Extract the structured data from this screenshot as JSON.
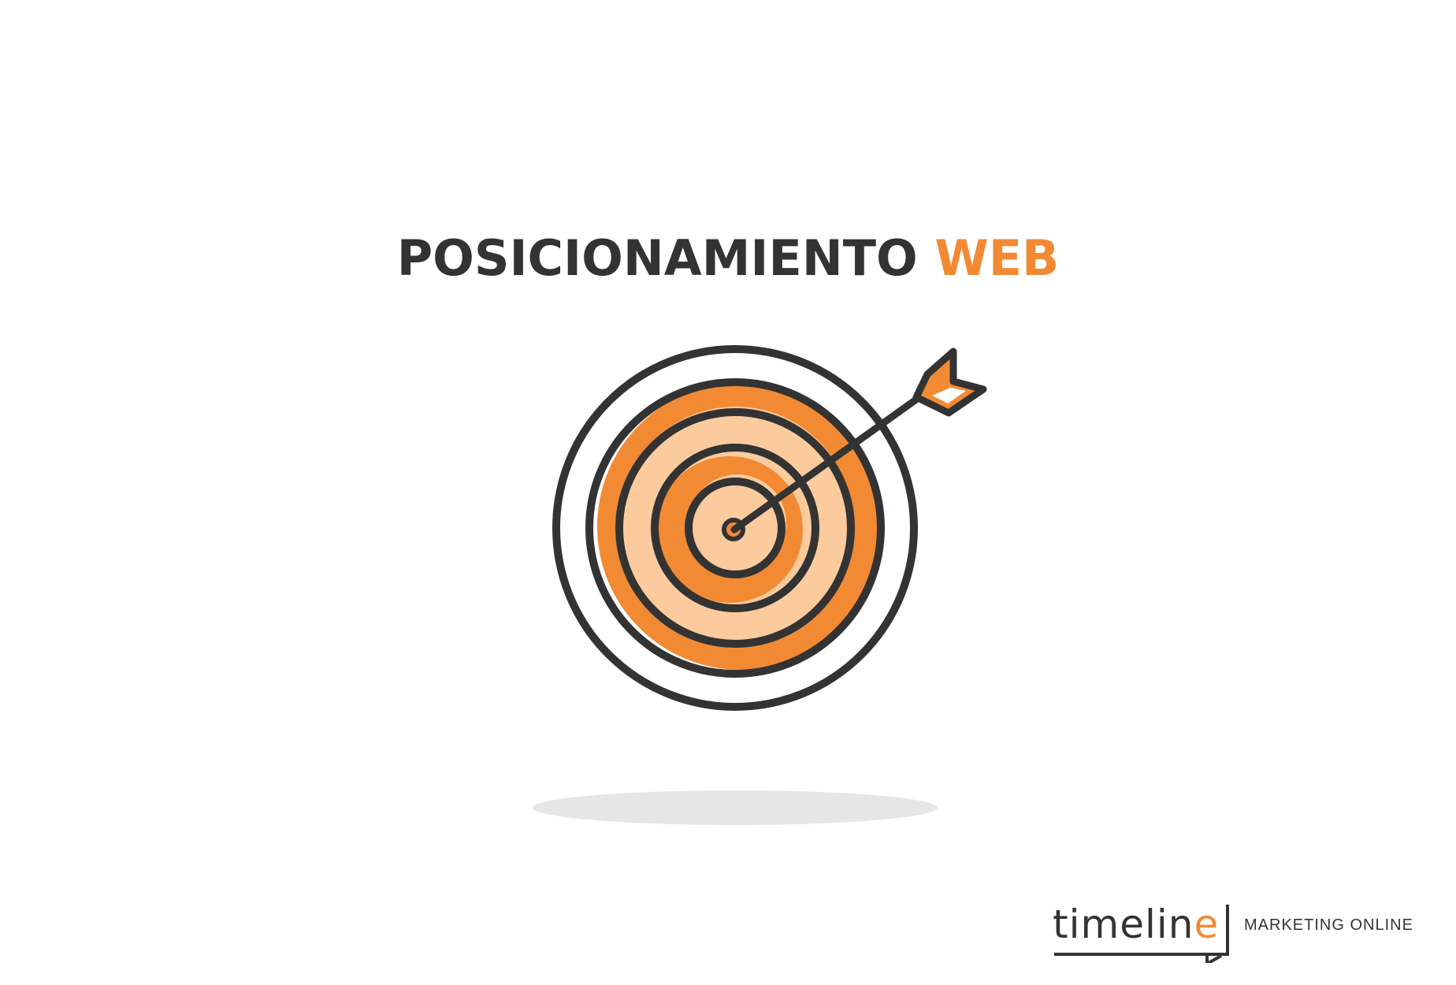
{
  "title": {
    "main": "POSICIONAMIENTO",
    "accent": "WEB"
  },
  "logo": {
    "word_main": "timelin",
    "word_accent": "e",
    "tagline": "MARKETING ONLINE"
  },
  "colors": {
    "dark": "#333333",
    "orange": "#f28a34",
    "light_orange": "#fbcb9e",
    "shadow": "#e6e6e6",
    "background": "#ffffff"
  },
  "icons": {
    "target": "target-icon",
    "arrow": "arrow-icon",
    "logo_bubble": "speech-bubble-icon"
  }
}
